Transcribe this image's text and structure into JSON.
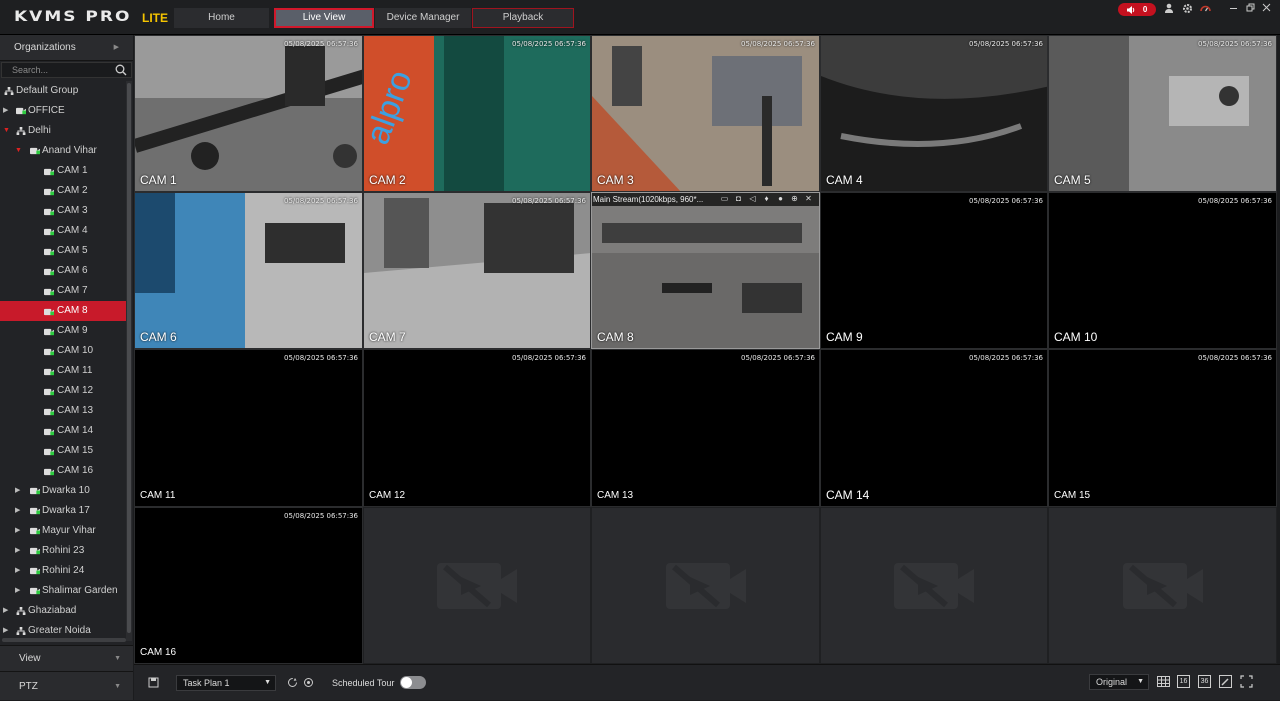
{
  "app": {
    "logo": "KVMS PRO",
    "edition": "LITE"
  },
  "nav": {
    "tabs": [
      "Home",
      "Live View",
      "Device Manager",
      "Playback"
    ],
    "active": "Live View"
  },
  "alarm": {
    "count": "0"
  },
  "sidebar": {
    "header": "Organizations",
    "search_placeholder": "Search...",
    "tree": [
      {
        "label": "Default Group",
        "type": "org"
      },
      {
        "label": "OFFICE",
        "type": "device"
      },
      {
        "label": "Delhi",
        "type": "org"
      },
      {
        "label": "Anand Vihar",
        "type": "device"
      },
      {
        "label": "CAM 1",
        "type": "cam"
      },
      {
        "label": "CAM 2",
        "type": "cam"
      },
      {
        "label": "CAM 3",
        "type": "cam"
      },
      {
        "label": "CAM 4",
        "type": "cam"
      },
      {
        "label": "CAM 5",
        "type": "cam"
      },
      {
        "label": "CAM 6",
        "type": "cam"
      },
      {
        "label": "CAM 7",
        "type": "cam"
      },
      {
        "label": "CAM 8",
        "type": "cam",
        "selected": true
      },
      {
        "label": "CAM 9",
        "type": "cam"
      },
      {
        "label": "CAM 10",
        "type": "cam"
      },
      {
        "label": "CAM 11",
        "type": "cam"
      },
      {
        "label": "CAM 12",
        "type": "cam"
      },
      {
        "label": "CAM 13",
        "type": "cam"
      },
      {
        "label": "CAM 14",
        "type": "cam"
      },
      {
        "label": "CAM 15",
        "type": "cam"
      },
      {
        "label": "CAM 16",
        "type": "cam"
      },
      {
        "label": "Dwarka 10",
        "type": "device"
      },
      {
        "label": "Dwarka 17",
        "type": "device"
      },
      {
        "label": "Mayur Vihar",
        "type": "device"
      },
      {
        "label": "Rohini 23",
        "type": "device"
      },
      {
        "label": "Rohini 24",
        "type": "device"
      },
      {
        "label": "Shalimar Garden",
        "type": "device"
      },
      {
        "label": "Ghaziabad",
        "type": "org"
      },
      {
        "label": "Greater Noida",
        "type": "org"
      }
    ],
    "panels": [
      "View",
      "PTZ"
    ]
  },
  "tiles": [
    {
      "label": "CAM 1",
      "ts": "05/08/2025 06:57:36"
    },
    {
      "label": "CAM 2",
      "ts": "05/08/2025 06:57:36"
    },
    {
      "label": "CAM 3",
      "ts": "05/08/2025 06:57:36"
    },
    {
      "label": "CAM 4",
      "ts": "05/08/2025 06:57:36"
    },
    {
      "label": "CAM 5",
      "ts": "05/08/2025 06:57:36"
    },
    {
      "label": "CAM 6",
      "ts": "05/08/2025 06:57:36"
    },
    {
      "label": "CAM 7",
      "ts": "05/08/2025 06:57:36"
    },
    {
      "label": "CAM 8",
      "ts": "",
      "stream": "Main Stream(1020kbps, 960*..."
    },
    {
      "label": "CAM 9",
      "ts": "05/08/2025 06:57:36"
    },
    {
      "label": "CAM 10",
      "ts": "05/08/2025 06:57:36"
    },
    {
      "label": "CAM 11",
      "ts": "05/08/2025 06:57:36"
    },
    {
      "label": "CAM 12",
      "ts": "05/08/2025 06:57:36"
    },
    {
      "label": "CAM 13",
      "ts": "05/08/2025 06:57:36"
    },
    {
      "label": "CAM 14",
      "ts": "05/08/2025 06:57:36"
    },
    {
      "label": "CAM 15",
      "ts": "05/08/2025 06:57:36"
    },
    {
      "label": "CAM 16",
      "ts": "05/08/2025 06:57:36"
    }
  ],
  "bottom": {
    "task_plan": "Task Plan 1",
    "scheduled_tour": "Scheduled Tour",
    "stream_mode": "Original",
    "layout_16": "16",
    "layout_36": "36"
  }
}
